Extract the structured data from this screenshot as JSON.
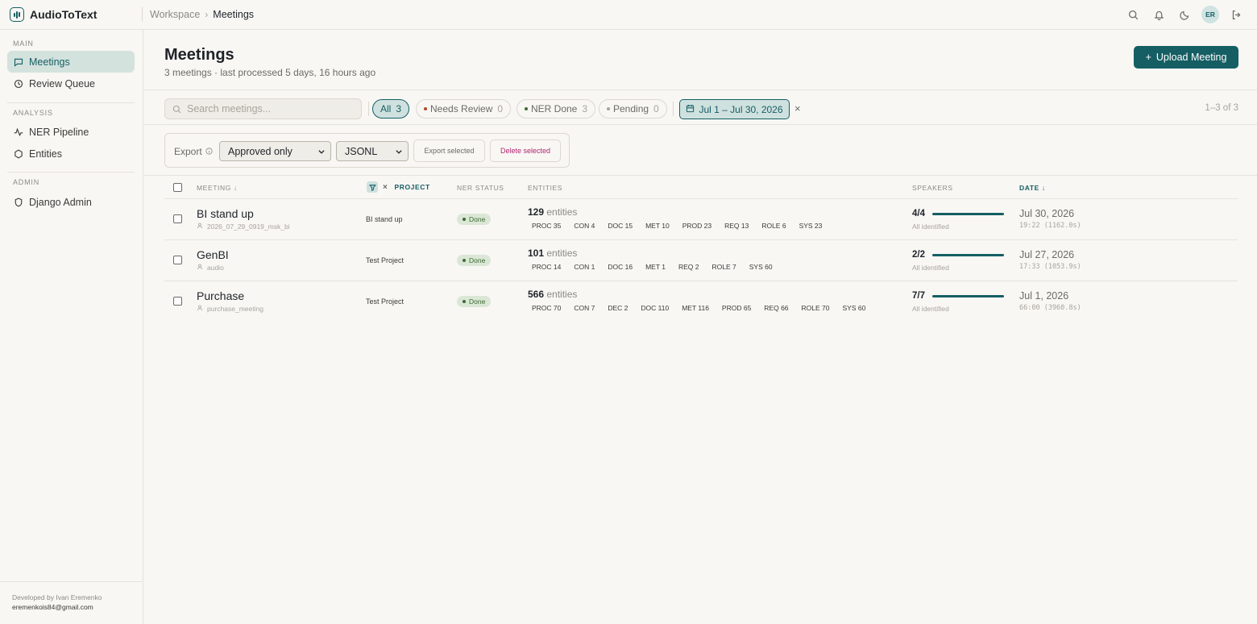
{
  "app": {
    "name": "AudioToText",
    "breadcrumb": [
      "Workspace",
      "Meetings"
    ],
    "user_initials": "ER",
    "accent": "#155e63"
  },
  "top_icons": [
    "search-icon",
    "bell-icon",
    "moon-icon",
    "logout-icon"
  ],
  "sidebar": {
    "sections": [
      {
        "title": "MAIN",
        "items": [
          {
            "label": "Meetings",
            "icon": "chat-icon",
            "active": true
          },
          {
            "label": "Review Queue",
            "icon": "clock-icon",
            "active": false
          }
        ]
      },
      {
        "title": "ANALYSIS",
        "items": [
          {
            "label": "NER Pipeline",
            "icon": "activity-icon",
            "active": false
          },
          {
            "label": "Entities",
            "icon": "hexagon-icon",
            "active": false
          }
        ]
      },
      {
        "title": "ADMIN",
        "items": [
          {
            "label": "Django Admin",
            "icon": "shield-icon",
            "active": false
          }
        ]
      }
    ],
    "footer": {
      "developed_by": "Developed by Ivan Eremenko",
      "email": "eremenkois84@gmail.com"
    }
  },
  "page": {
    "title": "Meetings",
    "subtitle": "3 meetings · last processed 5 days, 16 hours ago",
    "upload_label": "Upload Meeting"
  },
  "filters": {
    "search_placeholder": "Search meetings...",
    "chips": [
      {
        "label": "All",
        "count": "3",
        "active": true,
        "dot": ""
      },
      {
        "label": "Needs Review",
        "count": "0",
        "active": false,
        "dot": "#b5472a"
      },
      {
        "label": "NER Done",
        "count": "3",
        "active": false,
        "dot": "#3c6b33"
      },
      {
        "label": "Pending",
        "count": "0",
        "active": false,
        "dot": "#a8a49c"
      }
    ],
    "date_range": "Jul 1 – Jul 30, 2026",
    "clear": "×",
    "range_text": "1–3 of 3"
  },
  "export": {
    "label": "Export",
    "scope": "Approved only",
    "format": "JSONL",
    "export_selected": "Export selected",
    "delete_selected": "Delete selected"
  },
  "table": {
    "headers": {
      "meeting": "MEETING ↓",
      "project": "PROJECT",
      "ner_status": "NER STATUS",
      "entities": "ENTITIES",
      "speakers": "SPEAKERS",
      "date": "DATE ↓"
    },
    "rows": [
      {
        "title": "BI stand up",
        "file": "2026_07_29_0919_msk_bi",
        "project": "BI stand up",
        "status": "Done",
        "entities_count": "129",
        "entities_word": "entities",
        "tags": [
          "PROC 35",
          "CON 4",
          "DOC 15",
          "MET 10",
          "PROD 23",
          "REQ 13",
          "ROLE 6",
          "SYS 23"
        ],
        "speakers": "4/4",
        "speakers_fraction": 1.0,
        "speakers_note": "All identified",
        "date": "Jul 30, 2026",
        "duration": "19:22 (1162.0s)"
      },
      {
        "title": "GenBI",
        "file": "audio",
        "project": "Test Project",
        "status": "Done",
        "entities_count": "101",
        "entities_word": "entities",
        "tags": [
          "PROC 14",
          "CON 1",
          "DOC 16",
          "MET 1",
          "REQ 2",
          "ROLE 7",
          "SYS 60"
        ],
        "speakers": "2/2",
        "speakers_fraction": 1.0,
        "speakers_note": "All identified",
        "date": "Jul 27, 2026",
        "duration": "17:33 (1053.9s)"
      },
      {
        "title": "Purchase",
        "file": "purchase_meeting",
        "project": "Test Project",
        "status": "Done",
        "entities_count": "566",
        "entities_word": "entities",
        "tags": [
          "PROC 70",
          "CON 7",
          "DEC 2",
          "DOC 110",
          "MET 116",
          "PROD 65",
          "REQ 66",
          "ROLE 70",
          "SYS 60"
        ],
        "speakers": "7/7",
        "speakers_fraction": 1.0,
        "speakers_note": "All identified",
        "date": "Jul 1, 2026",
        "duration": "66:00 (3960.8s)"
      }
    ]
  }
}
